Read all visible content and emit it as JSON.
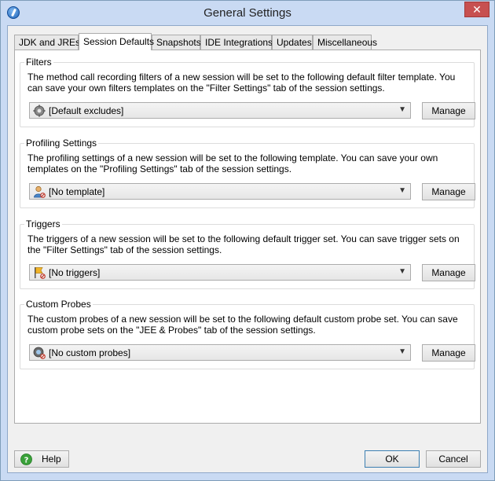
{
  "window": {
    "title": "General Settings",
    "close_label": "✕"
  },
  "tabs": [
    "JDK and JREs",
    "Session Defaults",
    "Snapshots",
    "IDE Integrations",
    "Updates",
    "Miscellaneous"
  ],
  "groups": {
    "filters": {
      "title": "Filters",
      "description": "The method call recording filters of a new session will be set to the following default filter template. You can save your own filters templates on the \"Filter Settings\" tab of the session settings.",
      "value": "[Default excludes]",
      "icon": "gear-icon",
      "manage_label": "Manage"
    },
    "profiling": {
      "title": "Profiling Settings",
      "description": "The profiling settings of a new session will be set to the following template. You can save your own templates on the \"Profiling Settings\" tab of the session settings.",
      "value": "[No template]",
      "icon": "user-settings-icon",
      "manage_label": "Manage"
    },
    "triggers": {
      "title": "Triggers",
      "description": "The triggers of a new session will be set to the following default trigger set. You can save trigger sets on the \"Filter Settings\" tab of the session settings.",
      "value": "[No triggers]",
      "icon": "trigger-flag-icon",
      "manage_label": "Manage"
    },
    "probes": {
      "title": "Custom Probes",
      "description": "The custom probes of a new session will be set to the following default custom probe set. You can save custom probe sets on the \"JEE & Probes\" tab of the session settings.",
      "value": "[No custom probes]",
      "icon": "probe-icon",
      "manage_label": "Manage"
    }
  },
  "footer": {
    "help_label": "Help",
    "ok_label": "OK",
    "cancel_label": "Cancel"
  },
  "colors": {
    "title_bar": "#c9daf3",
    "close_button": "#c75050",
    "focus_border": "#3c7fb1"
  }
}
